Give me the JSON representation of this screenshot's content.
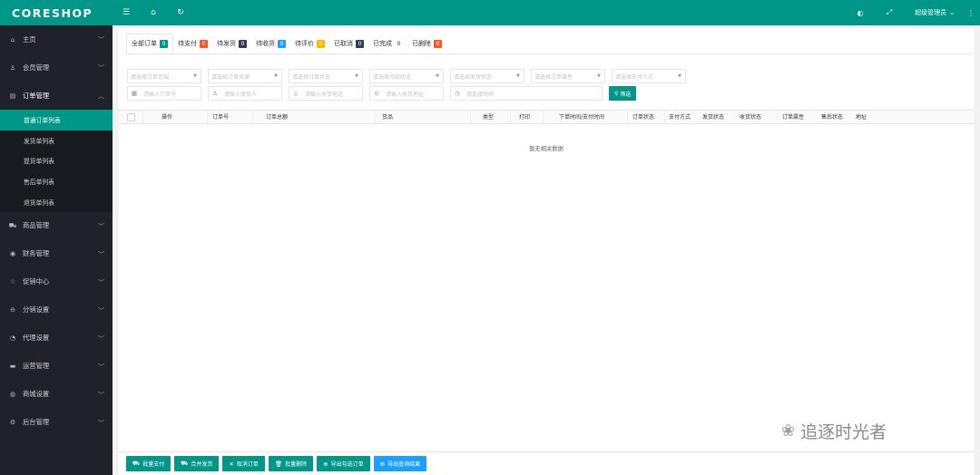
{
  "app": {
    "logo": "CORESHOP"
  },
  "topbar": {
    "left_icons": [
      {
        "name": "menu-toggle-icon",
        "glyph": "☰"
      },
      {
        "name": "home-icon",
        "glyph": "⌂"
      },
      {
        "name": "refresh-icon",
        "glyph": "↻"
      }
    ],
    "right_icons": [
      {
        "name": "theme-icon",
        "glyph": "◐"
      },
      {
        "name": "fullscreen-icon",
        "glyph": "⤢"
      }
    ],
    "admin_label": "超级管理员",
    "admin_caret": "⌄",
    "more_glyph": "⋮"
  },
  "sidebar": {
    "items": [
      {
        "label": "主页",
        "icon": "home-icon",
        "glyph": "⌂"
      },
      {
        "label": "会员管理",
        "icon": "user-icon",
        "glyph": "♙"
      },
      {
        "label": "订单管理",
        "icon": "order-icon",
        "glyph": "▤",
        "open": true,
        "children": [
          "普通订单列表",
          "发货单列表",
          "提货单列表",
          "售后单列表",
          "退货单列表"
        ]
      },
      {
        "label": "商品管理",
        "icon": "cart-icon",
        "glyph": "⛟"
      },
      {
        "label": "财务管理",
        "icon": "finance-icon",
        "glyph": "◉"
      },
      {
        "label": "促销中心",
        "icon": "promo-icon",
        "glyph": "☆"
      },
      {
        "label": "分销设置",
        "icon": "distribution-icon",
        "glyph": "⊖"
      },
      {
        "label": "代理设置",
        "icon": "agent-icon",
        "glyph": "◔"
      },
      {
        "label": "运营管理",
        "icon": "operation-icon",
        "glyph": "▬"
      },
      {
        "label": "商城设置",
        "icon": "mall-icon",
        "glyph": "◍"
      },
      {
        "label": "后台管理",
        "icon": "settings-icon",
        "glyph": "⚙"
      }
    ]
  },
  "tabs": [
    {
      "label": "全部订单",
      "count": "0",
      "color": "#009688",
      "active": true
    },
    {
      "label": "待支付",
      "count": "0",
      "color": "#ff5722"
    },
    {
      "label": "待发货",
      "count": "0",
      "color": "#2f4056"
    },
    {
      "label": "待收货",
      "count": "0",
      "color": "#1e9fff"
    },
    {
      "label": "待评价",
      "count": "0",
      "color": "#ffb800"
    },
    {
      "label": "已取消",
      "count": "0",
      "color": "#2f4056"
    },
    {
      "label": "已完成",
      "count": "0",
      "color": ""
    },
    {
      "label": "已删除",
      "count": "0",
      "color": "#ff5722"
    }
  ],
  "filters": {
    "selects": [
      "请选择订单范围",
      "请选择订单来源",
      "请选择订单状态",
      "请选择付款状态",
      "请选择发货状态",
      "请选择订单属性",
      "请选择支付方式"
    ],
    "inputs": [
      {
        "placeholder": "请输入订单号",
        "icon": "grid-icon",
        "glyph": "▦"
      },
      {
        "placeholder": "请输入收货人",
        "icon": "person-icon",
        "glyph": "♙"
      },
      {
        "placeholder": "请输入收货电话",
        "icon": "phone-icon",
        "glyph": "▯"
      },
      {
        "placeholder": "请输入收货地址",
        "icon": "location-icon",
        "glyph": "⊙"
      },
      {
        "placeholder": "请选择时间",
        "icon": "clock-icon",
        "glyph": "◷"
      }
    ],
    "filter_button": "筛选",
    "filter_glyph": "⚲"
  },
  "table": {
    "columns": [
      "操作",
      "订单号",
      "订单总额",
      "货品",
      "类型",
      "打印",
      "下单时间/支付时间",
      "订单状态",
      "支付方式",
      "发货状态",
      "收货状态",
      "订单属性",
      "售后状态",
      "地址"
    ],
    "empty_text": "暂无相关数据"
  },
  "bottom_buttons": [
    {
      "label": "批量支付",
      "glyph": "⛟",
      "color": "#009688"
    },
    {
      "label": "合并发货",
      "glyph": "⛟",
      "color": "#009688"
    },
    {
      "label": "取消订单",
      "glyph": "✕",
      "color": "#009688"
    },
    {
      "label": "批量删除",
      "glyph": "🗑",
      "color": "#009688"
    },
    {
      "label": "导出勾选订单",
      "glyph": "⊕",
      "color": "#009688"
    },
    {
      "label": "导出查询结果",
      "glyph": "⊕",
      "color": "#1e9fff"
    }
  ],
  "watermark": {
    "text": "追逐时光者",
    "glyph": "❀"
  }
}
